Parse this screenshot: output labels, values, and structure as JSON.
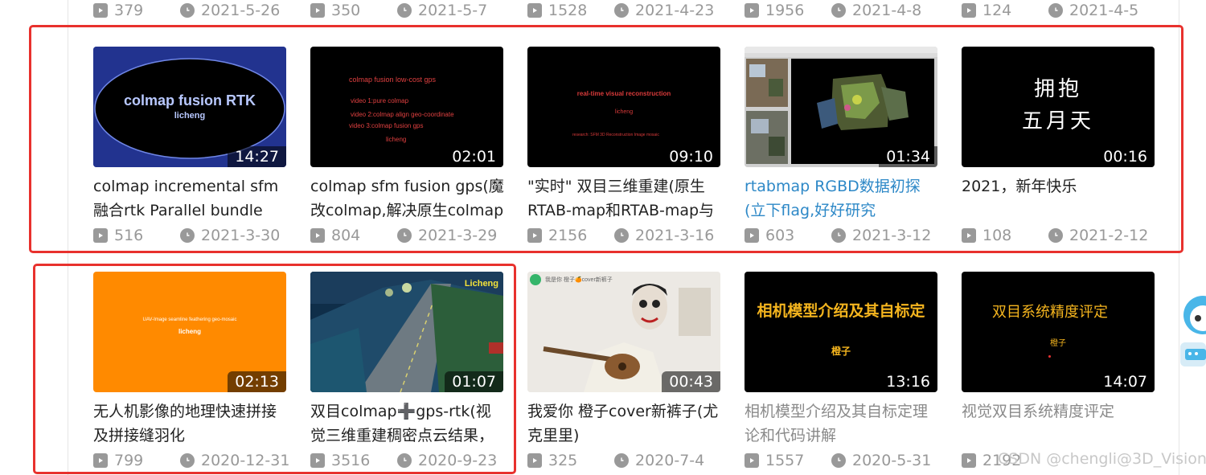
{
  "top_stats": [
    {
      "views": "379",
      "date": "2021-5-26"
    },
    {
      "views": "350",
      "date": "2021-5-7"
    },
    {
      "views": "1528",
      "date": "2021-4-23"
    },
    {
      "views": "1956",
      "date": "2021-4-8"
    },
    {
      "views": "124",
      "date": "2021-4-5"
    }
  ],
  "row1": [
    {
      "title": "colmap incremental sfm融合rtk Parallel bundle",
      "duration": "14:27",
      "views": "516",
      "date": "2021-3-30",
      "thumb_lines": [
        "colmap fusion RTK",
        "licheng"
      ]
    },
    {
      "title": "colmap sfm fusion gps(魔改colmap,解决原生colmap",
      "duration": "02:01",
      "views": "804",
      "date": "2021-3-29",
      "thumb_lines": [
        "colmap fusion low-cost gps",
        "video 1:pure colmap",
        "video 2:colmap align geo-coordinate",
        "video 3:colmap fusion gps",
        "licheng"
      ]
    },
    {
      "title": "\"实时\" 双目三维重建(原生RTAB-map和RTAB-map与",
      "duration": "09:10",
      "views": "2156",
      "date": "2021-3-16",
      "thumb_lines": [
        "real-time visual reconstruction",
        "licheng",
        "research: SFM  3D Reconstruction Image mosaic"
      ]
    },
    {
      "title": "rtabmap RGBD数据初探(立下flag,好好研究rtabmap 和",
      "duration": "01:34",
      "views": "603",
      "date": "2021-3-12",
      "thumb_lines": []
    },
    {
      "title": "2021，新年快乐",
      "duration": "00:16",
      "views": "108",
      "date": "2021-2-12",
      "thumb_lines": [
        "拥抱",
        "五月天"
      ]
    }
  ],
  "row2": [
    {
      "title": "无人机影像的地理快速拼接及拼接缝羽化",
      "duration": "02:13",
      "views": "799",
      "date": "2020-12-31",
      "thumb_lines": [
        "UAV-Image seamline feathering geo-mosaic",
        "licheng"
      ]
    },
    {
      "title": "双目colmap➕gps-rtk(视觉三维重建稠密点云结果，精度",
      "duration": "01:07",
      "views": "3516",
      "date": "2020-9-23",
      "thumb_lines": [
        "Licheng"
      ]
    },
    {
      "title": "我爱你 橙子cover新裤子(尤克里里)",
      "duration": "00:43",
      "views": "325",
      "date": "2020-7-4",
      "thumb_lines": [
        "我是你 橙子🍊cover新裤子"
      ]
    },
    {
      "title": "相机模型介绍及其自标定理论和代码讲解",
      "duration": "13:16",
      "views": "1557",
      "date": "2020-5-31",
      "thumb_lines": [
        "相机模型介绍及其自标定",
        "橙子"
      ]
    },
    {
      "title": "视觉双目系统精度评定",
      "duration": "14:07",
      "views": "2192",
      "date": "2020-5-28",
      "thumb_lines": [
        "双目系统精度评定",
        "橙子"
      ]
    }
  ],
  "watermark": "CSDN @chengli@3D_Vision",
  "colors": {
    "highlight": "#e8312d",
    "link": "#2d88c7",
    "meta": "#999999"
  }
}
